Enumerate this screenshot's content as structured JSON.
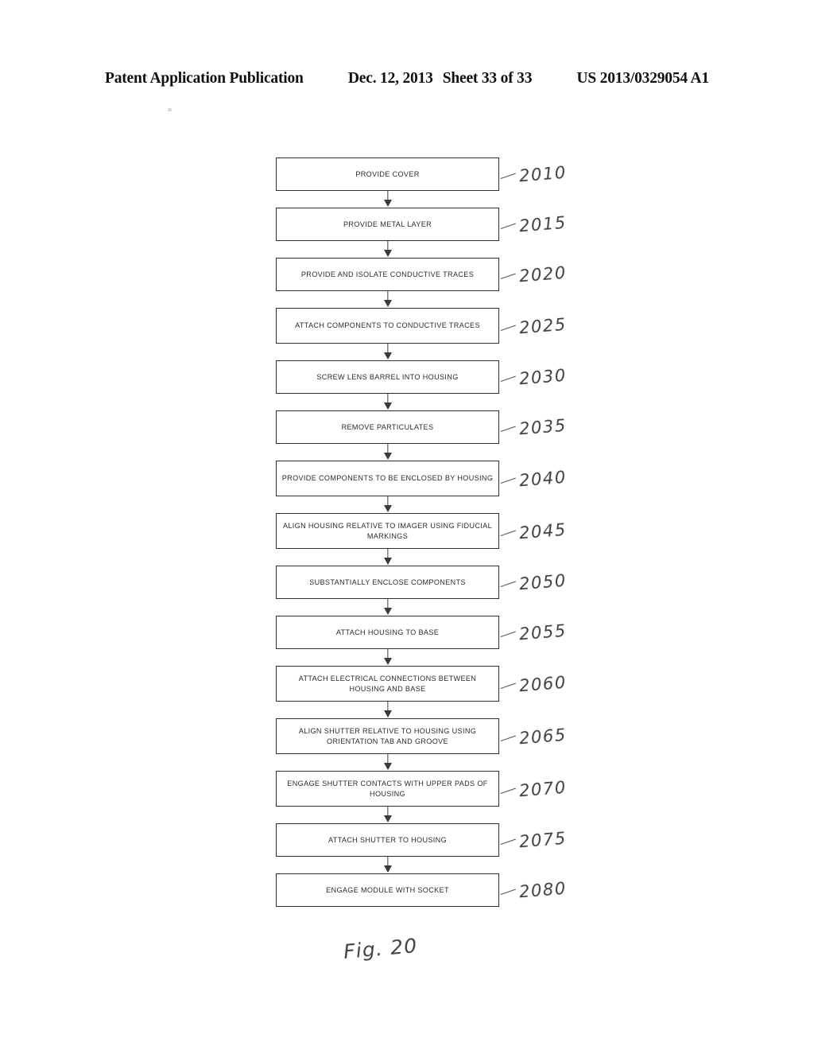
{
  "header": {
    "publication_label": "Patent Application Publication",
    "date": "Dec. 12, 2013",
    "sheet": "Sheet 33 of 33",
    "publication_number": "US 2013/0329054 A1"
  },
  "figure": {
    "caption": "Fig. 20",
    "type": "flowchart",
    "ink_color": "#2e2e2e",
    "page_background": "#ffffff"
  },
  "flowchart": {
    "steps": [
      {
        "ref": "2010",
        "label": "PROVIDE COVER",
        "lines": 1
      },
      {
        "ref": "2015",
        "label": "PROVIDE METAL LAYER",
        "lines": 1
      },
      {
        "ref": "2020",
        "label": "PROVIDE AND ISOLATE CONDUCTIVE TRACES",
        "lines": 1
      },
      {
        "ref": "2025",
        "label": "ATTACH COMPONENTS TO CONDUCTIVE TRACES",
        "lines": 2
      },
      {
        "ref": "2030",
        "label": "SCREW LENS BARREL INTO HOUSING",
        "lines": 1
      },
      {
        "ref": "2035",
        "label": "REMOVE PARTICULATES",
        "lines": 1
      },
      {
        "ref": "2040",
        "label": "PROVIDE COMPONENTS TO BE ENCLOSED BY HOUSING",
        "lines": 2
      },
      {
        "ref": "2045",
        "label": "ALIGN HOUSING RELATIVE TO IMAGER USING FIDUCIAL MARKINGS",
        "lines": 2
      },
      {
        "ref": "2050",
        "label": "SUBSTANTIALLY ENCLOSE COMPONENTS",
        "lines": 1
      },
      {
        "ref": "2055",
        "label": "ATTACH HOUSING TO BASE",
        "lines": 1
      },
      {
        "ref": "2060",
        "label": "ATTACH ELECTRICAL CONNECTIONS BETWEEN HOUSING AND BASE",
        "lines": 2
      },
      {
        "ref": "2065",
        "label": "ALIGN SHUTTER RELATIVE TO HOUSING USING ORIENTATION TAB AND GROOVE",
        "lines": 2
      },
      {
        "ref": "2070",
        "label": "ENGAGE SHUTTER CONTACTS WITH UPPER PADS OF HOUSING",
        "lines": 2
      },
      {
        "ref": "2075",
        "label": "ATTACH SHUTTER TO HOUSING",
        "lines": 1
      },
      {
        "ref": "2080",
        "label": "ENGAGE MODULE WITH SOCKET",
        "lines": 1
      }
    ]
  }
}
